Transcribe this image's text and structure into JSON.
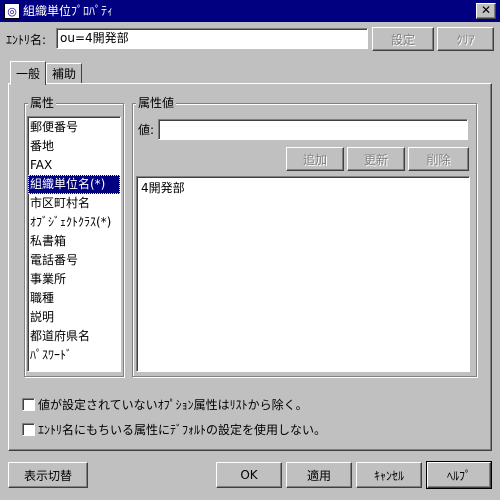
{
  "window": {
    "title": "組織単位ﾌﾟﾛﾊﾟﾃｨ",
    "close_symbol": "✕",
    "icon_symbol": "◎"
  },
  "entry": {
    "label": "ｴﾝﾄﾘ名:",
    "value": "ou=4開発部",
    "set_label": "設定",
    "clear_label": "ｸﾘｱ"
  },
  "tabs": [
    {
      "label": "一般"
    },
    {
      "label": "補助"
    }
  ],
  "attributes": {
    "group_title": "属性",
    "items": [
      {
        "label": "郵便番号"
      },
      {
        "label": "番地"
      },
      {
        "label": "FAX"
      },
      {
        "label": "組織単位名(*)"
      },
      {
        "label": "市区町村名"
      },
      {
        "label": "ｵﾌﾞｼﾞｪｸﾄｸﾗｽ(*)"
      },
      {
        "label": "私書箱"
      },
      {
        "label": "電話番号"
      },
      {
        "label": "事業所"
      },
      {
        "label": "職種"
      },
      {
        "label": "説明"
      },
      {
        "label": "都道府県名"
      },
      {
        "label": "ﾊﾟｽﾜｰﾄﾞ"
      }
    ],
    "selected": "組織単位名(*)"
  },
  "values": {
    "group_title": "属性値",
    "value_label": "値:",
    "value_input": "",
    "add_label": "追加",
    "update_label": "更新",
    "delete_label": "削除",
    "list": [
      "4開発部"
    ]
  },
  "options": {
    "exclude_unset_label": "値が設定されていないｵﾌﾟｼｮﾝ属性はﾘｽﾄから除く。",
    "exclude_unset_checked": false,
    "no_default_label": "ｴﾝﾄﾘ名にもちいる属性にﾃﾞﾌｫﾙﾄの設定を使用しない。",
    "no_default_checked": false
  },
  "footer": {
    "toggle_label": "表示切替",
    "ok_label": "OK",
    "apply_label": "適用",
    "cancel_label": "ｷｬﾝｾﾙ",
    "help_label": "ﾍﾙﾌﾟ"
  }
}
